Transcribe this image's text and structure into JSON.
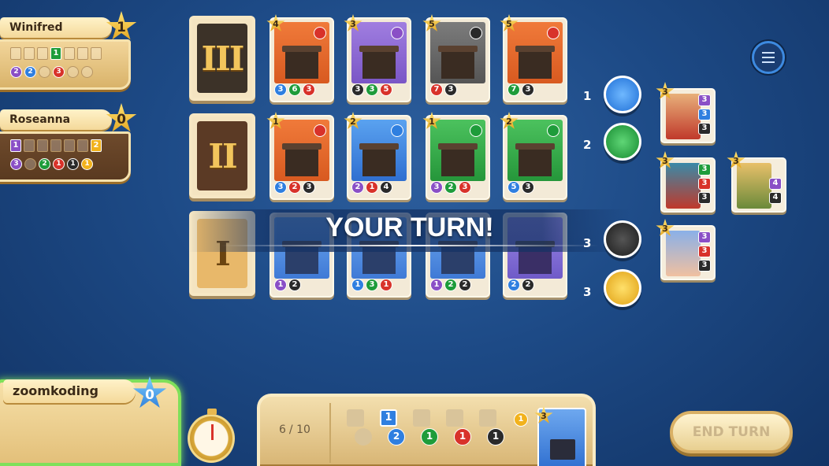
{
  "players": {
    "opponent1": {
      "name": "Winifred",
      "score": "1",
      "card_slots": [
        "",
        "",
        "1",
        "",
        "",
        ""
      ],
      "token_slots": [
        "2",
        "2",
        "",
        "3",
        "",
        ""
      ]
    },
    "opponent2": {
      "name": "Roseanna",
      "score": "0",
      "card_slots": [
        "1",
        "",
        "",
        "",
        "",
        "2"
      ],
      "token_slots": [
        "3",
        "",
        "2",
        "1",
        "1",
        "1"
      ]
    },
    "self": {
      "name": "zoomkoding",
      "score": "0"
    }
  },
  "tiers": [
    "III",
    "II",
    "I"
  ],
  "cards": {
    "tier3": [
      {
        "points": "4",
        "costs": [
          "3",
          "6",
          "3"
        ]
      },
      {
        "points": "3",
        "costs": [
          "3",
          "3",
          "5"
        ]
      },
      {
        "points": "5",
        "costs": [
          "7",
          "3"
        ]
      },
      {
        "points": "5",
        "costs": [
          "7",
          "3"
        ]
      }
    ],
    "tier2": [
      {
        "points": "1",
        "costs": [
          "3",
          "2",
          "3"
        ]
      },
      {
        "points": "2",
        "costs": [
          "2",
          "1",
          "4"
        ]
      },
      {
        "points": "1",
        "costs": [
          "3",
          "2",
          "3"
        ]
      },
      {
        "points": "2",
        "costs": [
          "5",
          "3"
        ]
      }
    ],
    "tier1": [
      {
        "costs": [
          "1",
          "2"
        ]
      },
      {
        "costs": [
          "1",
          "3",
          "1"
        ]
      },
      {
        "costs": [
          "1",
          "2",
          "2"
        ]
      },
      {
        "costs": [
          "2",
          "2"
        ]
      }
    ]
  },
  "tokens": [
    {
      "count": "1",
      "icon": "blue-gem-token-icon",
      "color": "#2f7fe0"
    },
    {
      "count": "2",
      "icon": "green-gem-token-icon",
      "color": "#1e9c3a"
    },
    {
      "count": "3",
      "icon": "black-gem-token-icon",
      "color": "#2a2a2a"
    },
    {
      "count": "3",
      "icon": "gold-token-icon",
      "color": "#f2b21c"
    }
  ],
  "nobles": [
    {
      "points": "3",
      "reqs": [
        "3",
        "3",
        "3"
      ]
    },
    {
      "points": "3",
      "reqs": [
        "3",
        "3",
        "3"
      ]
    },
    {
      "points": "3",
      "reqs": [
        "4",
        "4"
      ]
    },
    {
      "points": "3",
      "reqs": [
        "3",
        "3",
        "3"
      ]
    }
  ],
  "banner": {
    "text": "YOUR TURN!"
  },
  "tray": {
    "hand_count": "6",
    "hand_limit": "10",
    "card_badge": "1",
    "token_counts": [
      "2",
      "1",
      "1",
      "1"
    ],
    "gold_count": "1",
    "reserved_points": "3"
  },
  "end_turn": {
    "label": "END TURN"
  },
  "colors": {
    "red": "#d8322a",
    "green": "#1e9c3a",
    "blue": "#2f7fe0",
    "black": "#2a2a2a",
    "white": "#d8d8d8",
    "gold": "#f2b21c",
    "purple": "#8a4fc6"
  }
}
